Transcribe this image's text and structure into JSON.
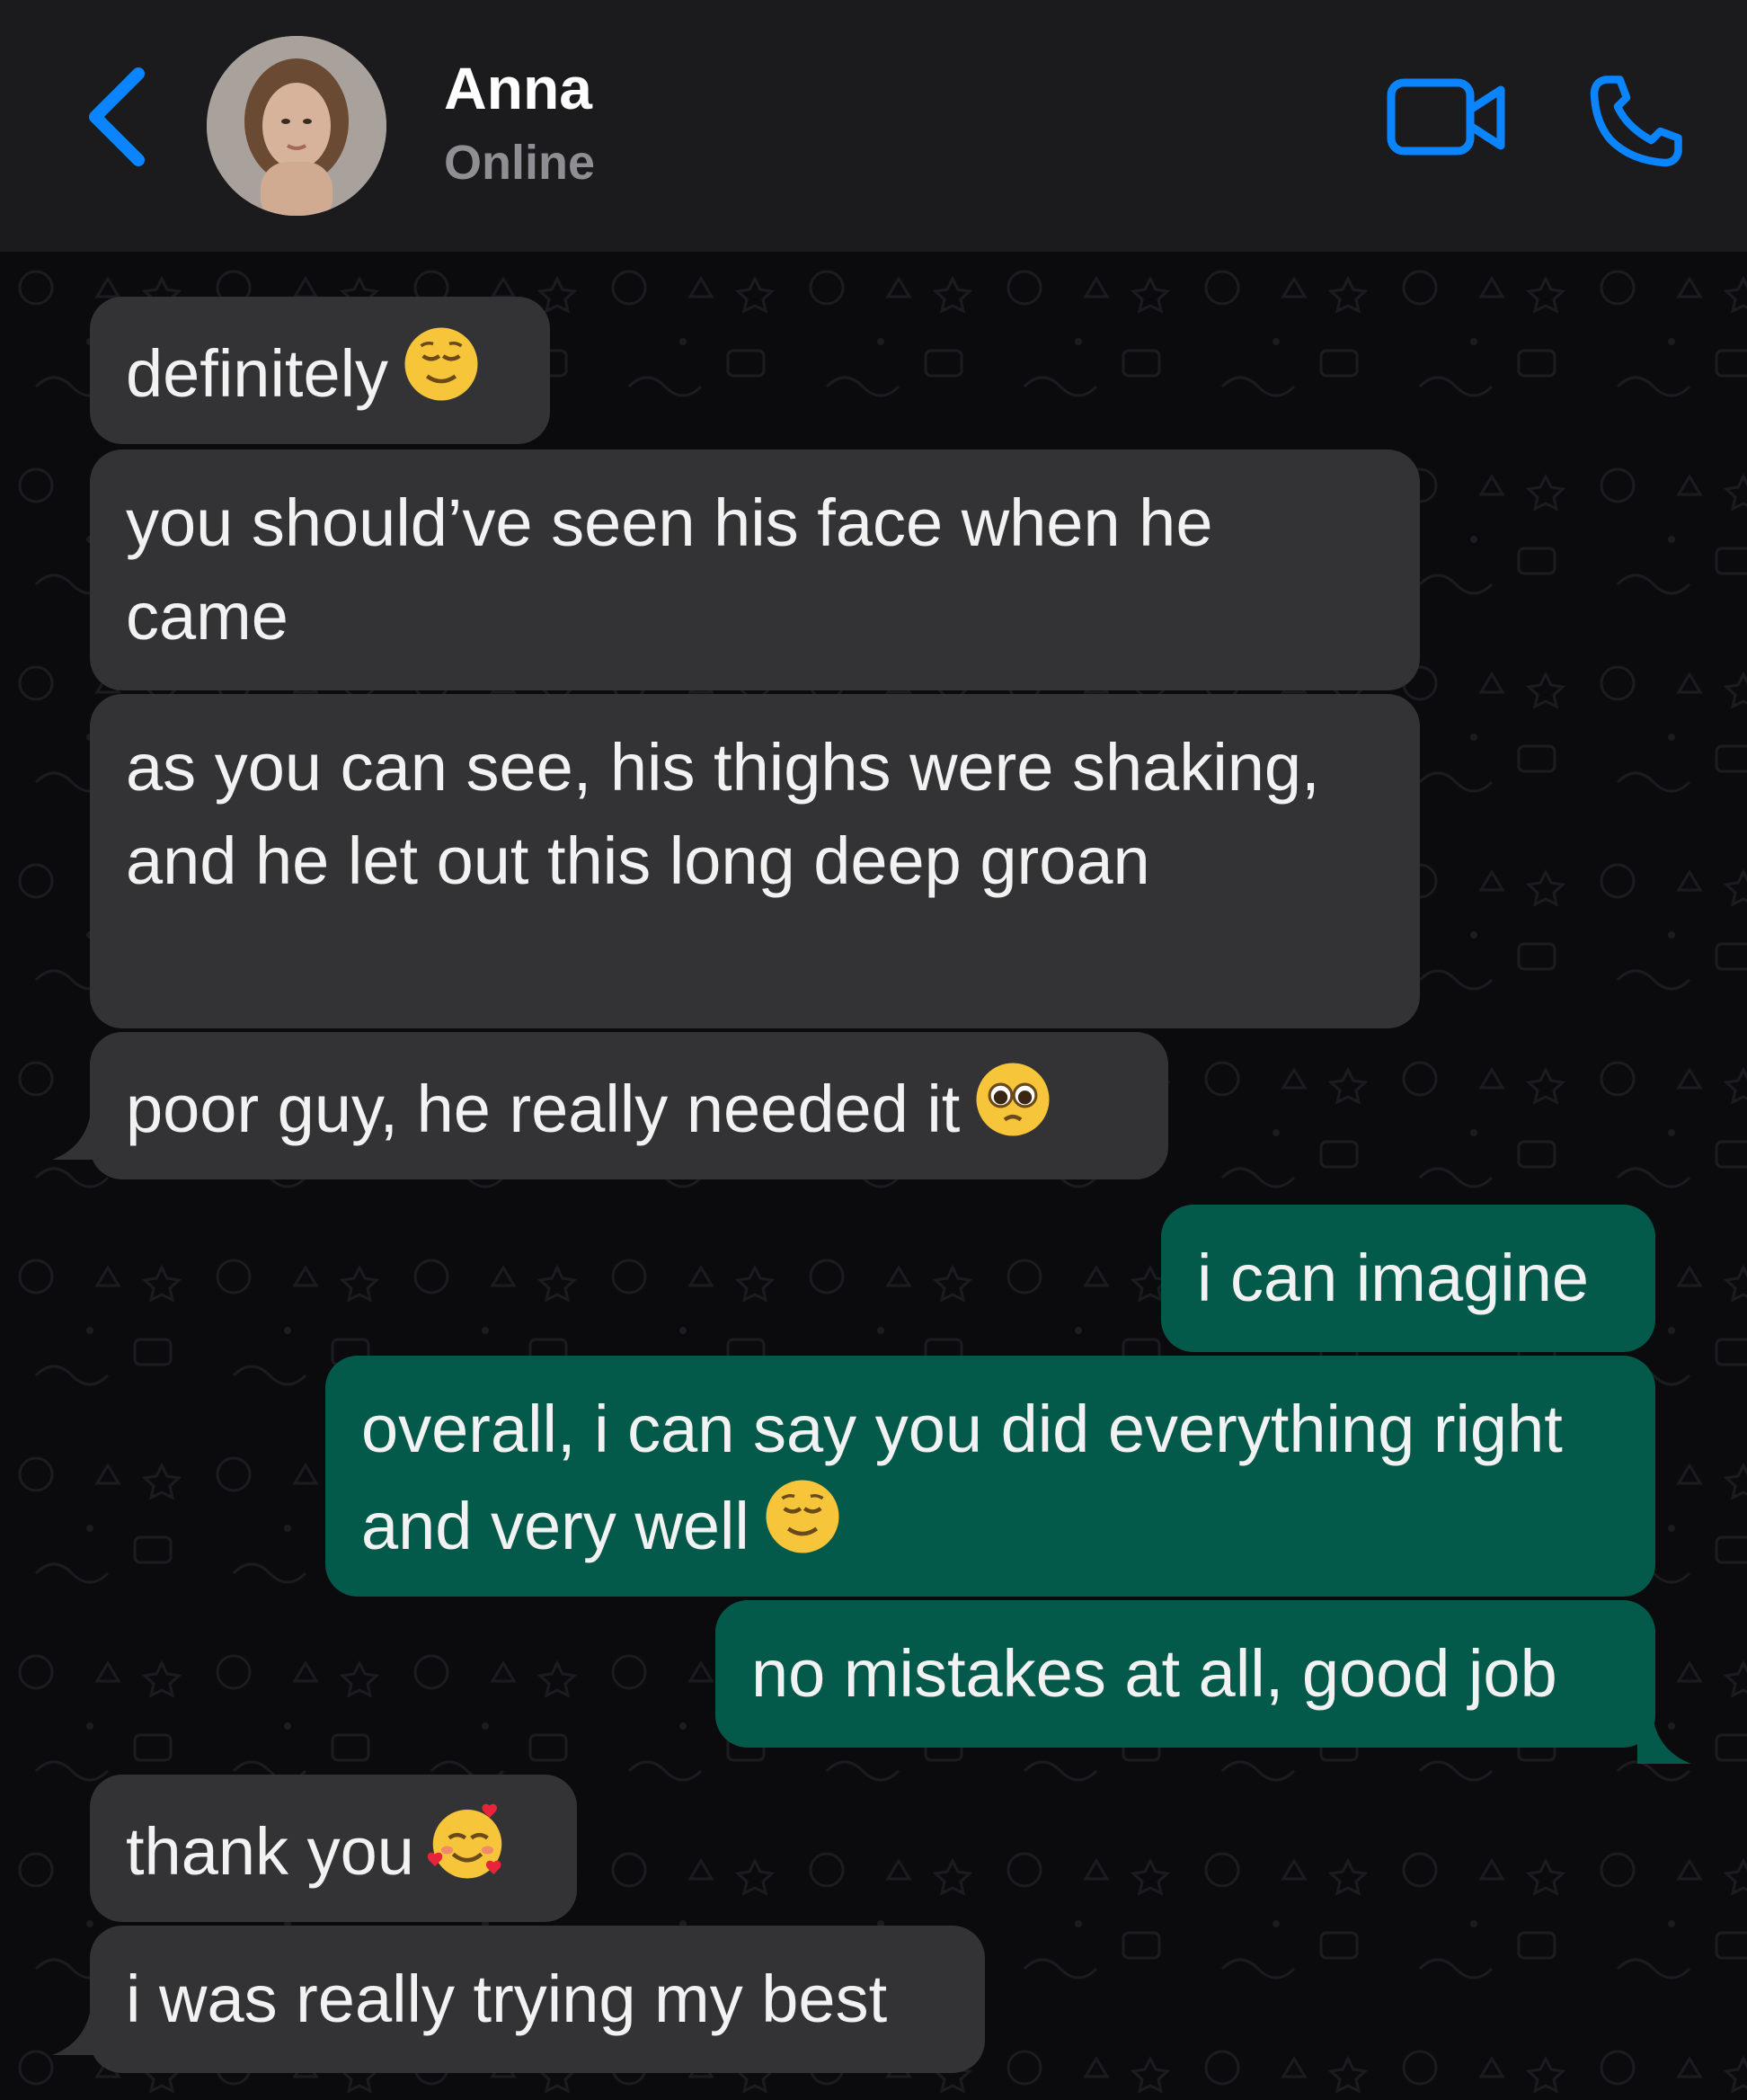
{
  "header": {
    "contact_name": "Anna",
    "status": "Online"
  },
  "icons": {
    "back": "chevron-left-icon",
    "video": "video-camera-icon",
    "call": "phone-icon"
  },
  "colors": {
    "accent": "#0a84ff",
    "incoming_bubble": "#333336",
    "outgoing_bubble": "#045a4a",
    "header_bg": "#1b1b1d",
    "chat_bg": "#0b0b0d"
  },
  "messages": [
    {
      "direction": "incoming",
      "text": "definitely",
      "emoji": "relieved-face"
    },
    {
      "direction": "incoming",
      "text": "you should’ve seen his face when he came"
    },
    {
      "direction": "incoming",
      "text": "as you can see, his thighs were shaking, and he let out this long deep groan"
    },
    {
      "direction": "incoming",
      "text": "poor guy, he really needed it",
      "emoji": "pleading-face"
    },
    {
      "direction": "outgoing",
      "text": "i can imagine"
    },
    {
      "direction": "outgoing",
      "text": "overall, i can say you did everything right and very well",
      "emoji": "relieved-face"
    },
    {
      "direction": "outgoing",
      "text": "no mistakes at all, good job"
    },
    {
      "direction": "incoming",
      "text": "thank you",
      "emoji": "smiling-face-with-hearts"
    },
    {
      "direction": "incoming",
      "text": "i was really trying my best"
    }
  ]
}
